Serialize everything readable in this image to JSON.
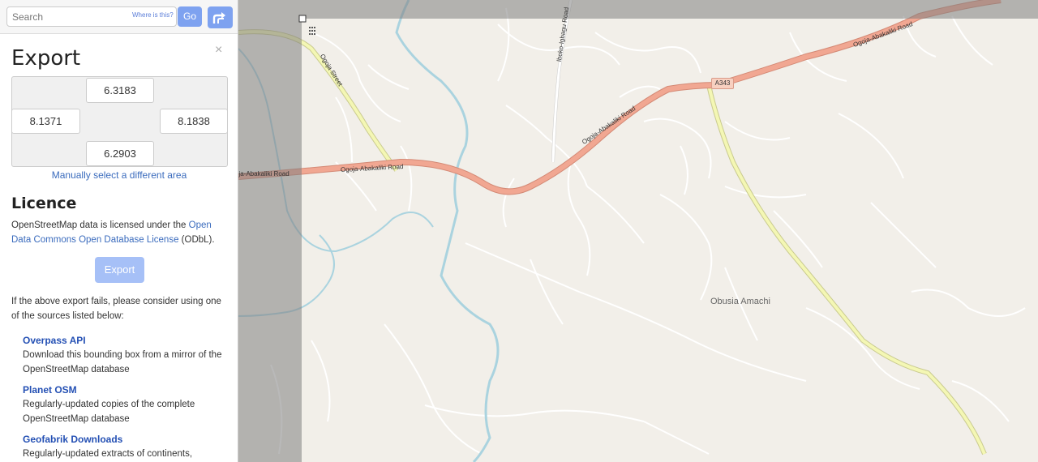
{
  "search": {
    "placeholder": "Search",
    "where_link": "Where is this?",
    "go_label": "Go"
  },
  "export_panel": {
    "title": "Export",
    "close_glyph": "×",
    "bbox": {
      "top": "6.3183",
      "left": "8.1371",
      "right": "8.1838",
      "bottom": "6.2903"
    },
    "manual_select_label": "Manually select a different area",
    "licence_title": "Licence",
    "licence_text_before": "OpenStreetMap data is licensed under the ",
    "licence_link": "Open Data Commons Open Database License",
    "licence_text_after": " (ODbL).",
    "export_button_label": "Export",
    "fail_text": "If the above export fails, please consider using one of the sources listed below:",
    "sources": [
      {
        "title": "Overpass API",
        "description": "Download this bounding box from a mirror of the OpenStreetMap database"
      },
      {
        "title": "Planet OSM",
        "description": "Regularly-updated copies of the complete OpenStreetMap database"
      },
      {
        "title": "Geofabrik Downloads",
        "description": "Regularly-updated extracts of continents,"
      }
    ]
  },
  "map": {
    "road_labels": {
      "ogoja_street": "Ogoja Street",
      "iboko_road": "Iboko-Igbagu Road",
      "oa_road_left": "oja-Abakaliki Road",
      "oa_road_mid": "Ogoja-Abakaliki Road",
      "oa_road_center": "Ogoja-Abakaliki Road",
      "oa_road_right": "Ogoja-Abakaliki Road"
    },
    "route_shield": "A343",
    "place_label": "Obusia Amachi",
    "colors": {
      "background": "#f2efe9",
      "trunk_road": "#f1a792",
      "secondary_road": "#f4f7b4",
      "river": "#aad3df",
      "minor_road": "#ffffff",
      "overlay": "#808080"
    }
  }
}
